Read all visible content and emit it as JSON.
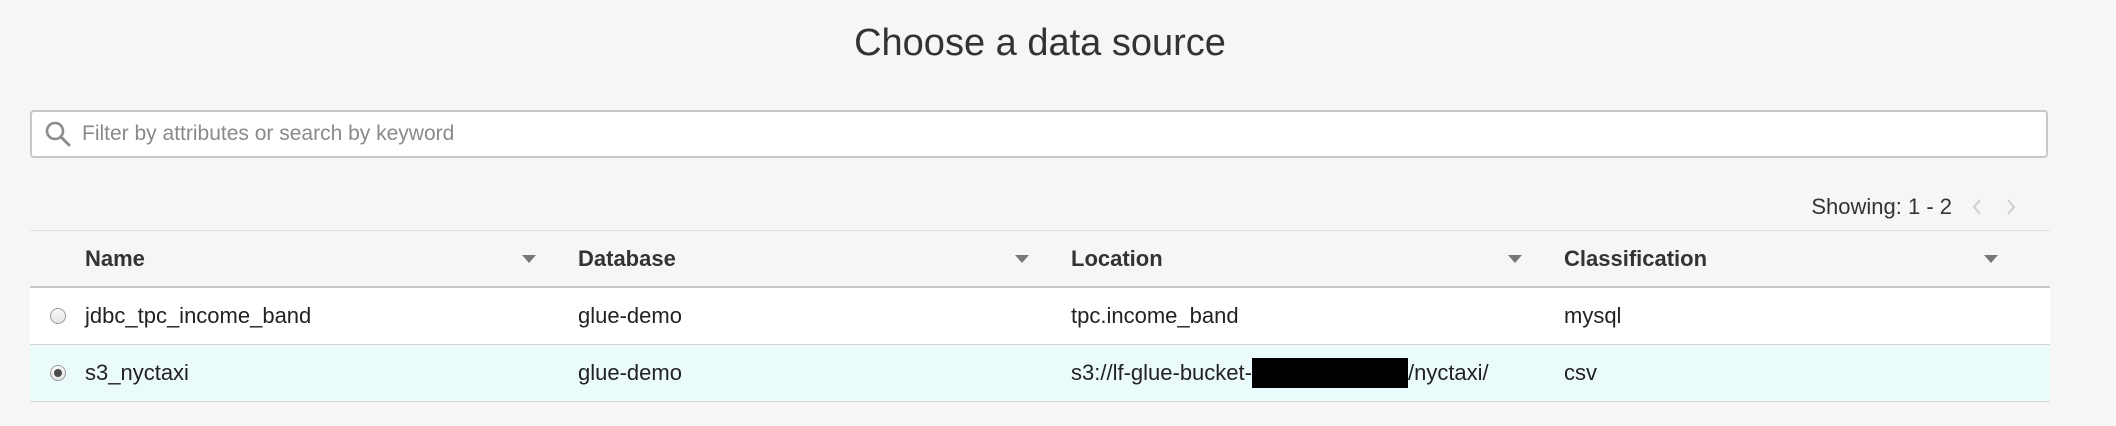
{
  "page": {
    "title": "Choose a data source"
  },
  "search": {
    "placeholder": "Filter by attributes or search by keyword",
    "value": ""
  },
  "pager": {
    "label": "Showing: 1 - 2"
  },
  "table": {
    "columns": [
      "Name",
      "Database",
      "Location",
      "Classification"
    ],
    "rows": [
      {
        "name": "jdbc_tpc_income_band",
        "database": "glue-demo",
        "location": "tpc.income_band",
        "location_suffix": "",
        "classification": "mysql",
        "selected": false
      },
      {
        "name": "s3_nyctaxi",
        "database": "glue-demo",
        "location": "s3://lf-glue-bucket-",
        "location_suffix": "/nyctaxi/",
        "classification": "csv",
        "selected": true
      }
    ]
  },
  "colors": {
    "selected_row": "#ebfafa",
    "background": "#f5f6f5"
  },
  "icons": {
    "search": "search-icon",
    "prev": "chevron-left-icon",
    "next": "chevron-right-icon",
    "sort": "caret-down-icon"
  }
}
